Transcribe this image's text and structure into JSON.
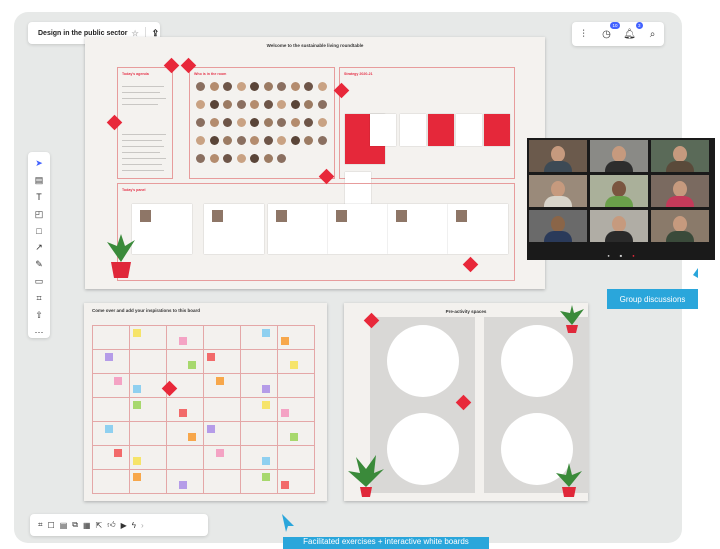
{
  "topbar": {
    "board_title": "Design in the public sector",
    "star_icon": "star-icon",
    "share_icon": "upload-share-icon",
    "icons": [
      "settings-sliders-icon",
      "timer-icon",
      "bell-icon",
      "search-icon"
    ],
    "timer_badge": "10",
    "bell_badge": "3"
  },
  "toolbar_left": {
    "icons": [
      "cursor-icon",
      "frame-template-icon",
      "text-icon",
      "sticky-note-icon",
      "shape-icon",
      "connector-line-icon",
      "pen-icon",
      "comment-icon",
      "frame-icon",
      "upload-icon",
      "more-icon"
    ]
  },
  "toolbar_bottom": {
    "icons": [
      "grid-frame-icon",
      "chat-icon",
      "notes-icon",
      "cards-icon",
      "kanban-icon",
      "share-screen-icon",
      "like-icon",
      "video-icon",
      "lightning-icon"
    ],
    "more_icon": "chevron-icon"
  },
  "board_main": {
    "title": "Welcome to the sustainable living roundtable",
    "agenda_title": "Today's agenda",
    "participants_title": "Who is in the room",
    "strategy_title": "Strategy 2020-21",
    "layout_title": "Today's panel"
  },
  "board_exercise": {
    "title": "Come over and add your inspirations to this board"
  },
  "board_groups": {
    "title": "Pre-activity spaces"
  },
  "labels": {
    "group_discussions": "Group discussions",
    "facilitated": "Facilitated exercises + interactive white boards"
  },
  "colors": {
    "accent_red": "#e8283a",
    "label_blue": "#2aa6db",
    "canvas_bg": "#e7e9e8"
  }
}
